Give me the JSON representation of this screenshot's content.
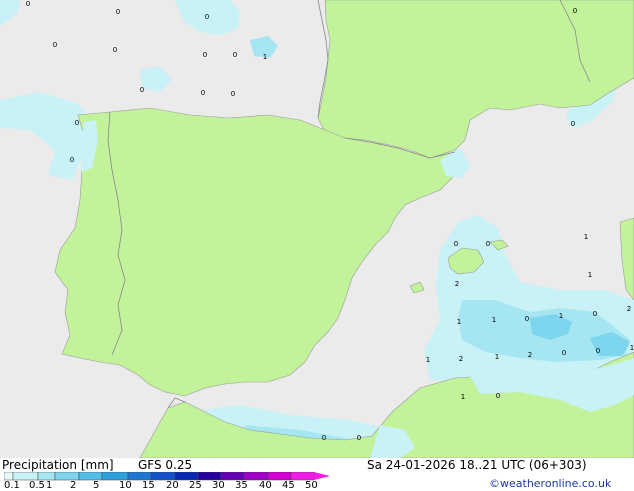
{
  "map": {
    "colors": {
      "sea": "#ebebeb",
      "land": "#c2f29a",
      "border": "#888888",
      "precip_light": "#c8f2f6",
      "precip_mid": "#a6e6f2",
      "precip_strong": "#7dd5ee"
    },
    "value_labels": [
      "0",
      "0",
      "0",
      "0",
      "0",
      "0",
      "0",
      "1",
      "0",
      "0",
      "0",
      "0",
      "0",
      "0",
      "0",
      "0",
      "0",
      "1",
      "1",
      "2",
      "1",
      "1",
      "0",
      "1",
      "0",
      "2",
      "1",
      "2",
      "1",
      "2",
      "0",
      "0",
      "1",
      "1",
      "0",
      "0",
      "0"
    ]
  },
  "footer": {
    "title": "Precipitation [mm]",
    "model": "GFS 0.25",
    "datetime": "Sa 24-01-2026 18..21 UTC (06+303)",
    "credit": "©weatheronline.co.uk",
    "legend_ticks": [
      "0.1",
      "0.5",
      "1",
      "2",
      "5",
      "10",
      "15",
      "20",
      "25",
      "30",
      "35",
      "40",
      "45",
      "50"
    ],
    "legend_colors": [
      "#e6fafa",
      "#c8f2f6",
      "#a6e6f2",
      "#7dd5ee",
      "#52bde6",
      "#2e9ede",
      "#1e78d2",
      "#1450c8",
      "#0a28b4",
      "#2800a0",
      "#6400b4",
      "#a000c8",
      "#d200d2",
      "#f01ee6"
    ]
  }
}
